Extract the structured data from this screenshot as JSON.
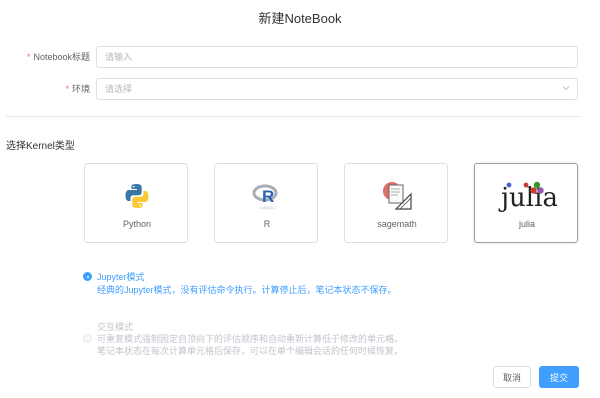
{
  "dialog": {
    "title": "新建NoteBook"
  },
  "form": {
    "notebook_title": {
      "label": "Notebook标题",
      "placeholder": "请输入",
      "value": ""
    },
    "environment": {
      "label": "环境",
      "placeholder": "请选择",
      "value": ""
    }
  },
  "kernel_section": {
    "title": "选择Kernel类型",
    "kernels": [
      {
        "name": "Python",
        "icon": "python-logo-icon",
        "selected": false
      },
      {
        "name": "R",
        "icon": "r-logo-icon",
        "selected": false
      },
      {
        "name": "sagemath",
        "icon": "sagemath-logo-icon",
        "selected": false
      },
      {
        "name": "julia",
        "icon": "julia-logo-icon",
        "selected": true
      }
    ]
  },
  "modes": {
    "jupyter": {
      "title": "Jupyter模式",
      "desc": "经典的Jupyter模式，没有评估命令执行。计算停止后，笔记本状态不保存。",
      "checked": true
    },
    "interactive": {
      "title": "交互模式",
      "desc_line1": "可重复模式强制固定自顶向下的评估顺序和自动重新计算低于修改的单元格。",
      "desc_line2": "笔记本状态在每次计算单元格后保存，可以在单个编辑会话的任何时候恢复。",
      "checked": false,
      "disabled": true
    }
  },
  "footer": {
    "cancel_label": "取消",
    "submit_label": "提交"
  },
  "colors": {
    "primary": "#409eff",
    "required": "#f56c6c",
    "border": "#dcdfe6"
  }
}
